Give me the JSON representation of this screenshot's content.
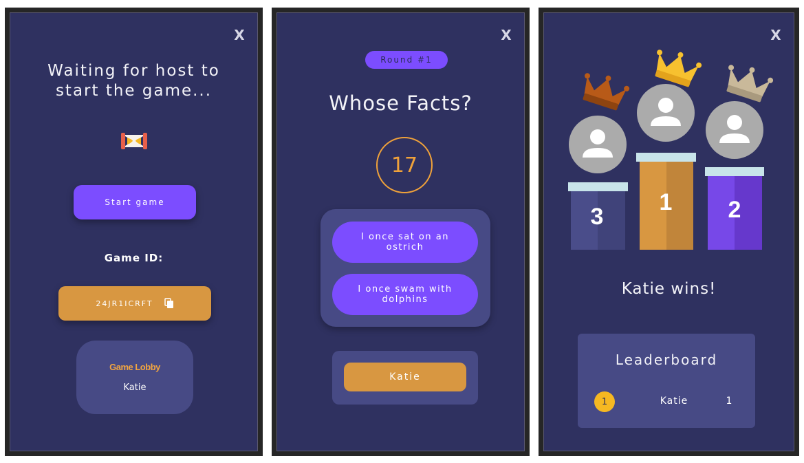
{
  "waiting_screen": {
    "close_label": "X",
    "title_line1": "Waiting for host to",
    "title_line2": "start the game...",
    "hourglass_icon": "hourglass-icon",
    "start_button": "Start game",
    "game_id_label": "Game ID:",
    "game_code": "24JR1ICRFT",
    "copy_icon": "copy-icon",
    "lobby_title": "Game Lobby",
    "lobby_players": [
      "Katie"
    ]
  },
  "round_screen": {
    "close_label": "X",
    "round_label": "Round #1",
    "title": "Whose Facts?",
    "timer": "17",
    "facts": [
      "I once sat on an ostrich",
      "I once swam with dolphins"
    ],
    "answer_button": "Katie"
  },
  "results_screen": {
    "close_label": "X",
    "podium": [
      {
        "place": "3",
        "crown": "bronze"
      },
      {
        "place": "1",
        "crown": "gold"
      },
      {
        "place": "2",
        "crown": "silver"
      }
    ],
    "winner_text": "Katie wins!",
    "leaderboard_title": "Leaderboard",
    "leaderboard": [
      {
        "rank": "1",
        "name": "Katie",
        "score": "1"
      }
    ]
  },
  "colors": {
    "background": "#2f3160",
    "card": "#474a85",
    "purple": "#7c4dff",
    "orange": "#d89741",
    "gold": "#f6b822"
  }
}
